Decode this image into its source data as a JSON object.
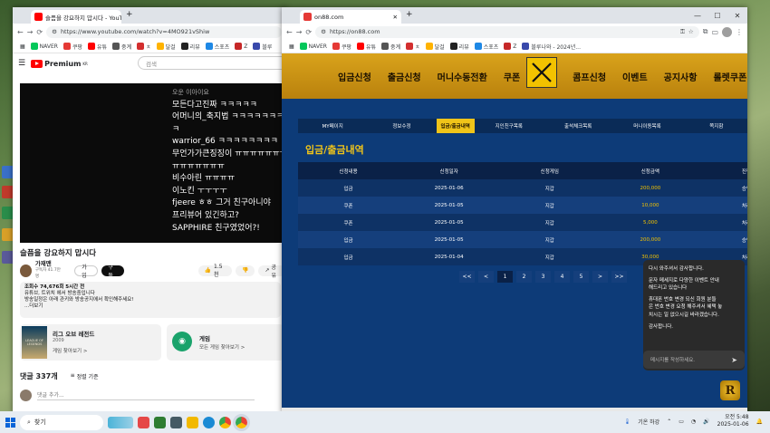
{
  "youtube_window": {
    "tab_title": "슬픔을 강요하지 맙시다 - YouTube",
    "url": "https://www.youtube.com/watch?v=4MO921vShiw",
    "bookmarks": [
      "NAVER",
      "쿠팡",
      "유튜",
      "중계",
      "ㅊ",
      "달걸",
      "리뷰",
      "스포츠",
      "Z",
      "블루"
    ],
    "logo_text": "Premium",
    "logo_sup": "KR",
    "search_placeholder": "검색",
    "chat_lines": [
      "오운 이아이요",
      "모든다고진짜 ㅋㅋㅋㅋㅋ",
      "어머니의_축지법 ㅋㅋㅋㅋㅋㅋㅋ",
      "ㅋ",
      "warrior_66 ㅋㅋㅋㅋㅋㅋㅋㅋ",
      "무언가가큰징징이 ㅠㅠㅠㅠㅠㅠㅠ",
      "ㅠㅠㅠㅠㅠㅠㅠ",
      "비수아린 ㅠㅠㅠㅠ",
      "이노킨 ㅜㅜㅜㅜ",
      "fjeere ㅎㅎ 그거 친구아니야",
      "프리뷰어 있긴하고?",
      "SAPPHIRE 친구였었어?!"
    ],
    "video_title": "슬픔을 강요하지 맙시다",
    "channel_name": "가재맨",
    "subscribers": "구독자 41.7만명",
    "join_label": "가입",
    "subscribe_label": "구독",
    "likes": "1.5천",
    "share_label": "공유",
    "description_lines": [
      "조회수 74,676회 5시간 전",
      "유튜브, 트위치 에서 방송중입니다",
      "방송일정은 아래 관키와 방송공지에서 확인해주세요!",
      "...더보기"
    ],
    "game_card": {
      "title": "리그 오브 레전드",
      "year": "2009",
      "link": "게임 찾아보기 >",
      "thumb": "LEAGUE OF LEGENDS"
    },
    "category_card": {
      "title": "게임",
      "link": "모든 게임 찾아보기 >"
    },
    "comments_count": "댓글 337개",
    "sort_label": "정렬 기준",
    "comment_placeholder": "댓글 추가..."
  },
  "site_window": {
    "tab_title": "on88.com",
    "url": "https://on88.com",
    "bookmarks": [
      "NAVER",
      "쿠팡",
      "유튜",
      "중계",
      "ㅊ",
      "달걸",
      "리뷰",
      "스포츠",
      "Z",
      "블루나와 - 2024년..."
    ],
    "nav": [
      "입금신청",
      "출금신청",
      "머니수동전환",
      "쿠폰",
      "콤프신청",
      "이벤트",
      "공지사항",
      "롤렛쿠폰"
    ],
    "sub_tabs": [
      "MY페이지",
      "정보수정",
      "입금/출금내역",
      "지인친구목록",
      "출석체크목록",
      "머니이동목록",
      "쪽지함"
    ],
    "active_sub_tab": "입금/출금내역",
    "section_title": "입금/출금내역",
    "table": {
      "headers": [
        "신청내용",
        "신청일자",
        "신청게임",
        "신청금액",
        "진행"
      ],
      "rows": [
        [
          "입금",
          "2025-01-06",
          "지갑",
          "200,000",
          "승인"
        ],
        [
          "쿠폰",
          "2025-01-05",
          "지갑",
          "10,000",
          "처리"
        ],
        [
          "쿠폰",
          "2025-01-05",
          "지갑",
          "5,000",
          "처리"
        ],
        [
          "입금",
          "2025-01-05",
          "지갑",
          "200,000",
          "승인"
        ],
        [
          "입금",
          "2025-01-04",
          "지갑",
          "30,000",
          "처리"
        ]
      ]
    },
    "pager": [
      "<<",
      "<",
      "1",
      "2",
      "3",
      "4",
      "5",
      ">",
      ">>"
    ],
    "current_page": "1",
    "popup_lines": [
      "다시 와주셔서 감사합니다.",
      "",
      "문자 메세지로 다양한 이벤트 안내",
      "해드리고 있습니다",
      "",
      "휴대폰 번호 변경 되신 회원 분들",
      "은 번호 변경 요청 해주셔서 혜택 놓",
      "치시는 일 없으시길 바라겠습니다.",
      "",
      "감사합니다."
    ],
    "chat_placeholder": "메시지를 작성하세요.",
    "corner_logo": "R"
  },
  "taskbar": {
    "search_label": "찾기",
    "weather": "기온 하강",
    "time": "오전 5:48",
    "date": "2025-01-06"
  },
  "colors": {
    "site_bg": "#0d3b78",
    "site_nav": "#d9a31b",
    "accent_gold": "#f2c200",
    "yt_red": "#ff0000"
  }
}
